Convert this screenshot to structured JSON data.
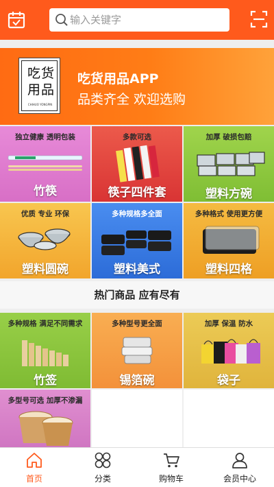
{
  "header": {
    "search_placeholder": "输入关键字",
    "left_icon": "calendar-icon",
    "right_icon": "scan-icon"
  },
  "banner": {
    "logo_text": "吃货用品",
    "logo_subtext": "CHIHUO YONGPIN",
    "title": "吃货用品APP",
    "subtitle": "品类齐全 欢迎选购"
  },
  "categories": [
    {
      "tag": "独立健康 透明包装",
      "name": "竹筷",
      "bg": "#e07fce"
    },
    {
      "tag": "多款可选",
      "name": "筷子四件套",
      "bg": "#e5453f"
    },
    {
      "tag": "加厚 破损包赔",
      "name": "塑料方碗",
      "bg": "#8ec93d"
    },
    {
      "tag": "优质 专业 环保",
      "name": "塑料圆碗",
      "bg": "#f6b93b"
    },
    {
      "tag": "多种规格多全面",
      "name": "塑料美式",
      "bg": "#3b7fe8"
    },
    {
      "tag": "多种格式 使用更方便",
      "name": "塑料四格",
      "bg": "#f2aa2f"
    }
  ],
  "section": {
    "title": "热门商品 应有尽有"
  },
  "hot_products": [
    {
      "tag": "多种规格 满足不同需求",
      "name": "竹签",
      "bg": "#8dc63f"
    },
    {
      "tag": "多种型号更全面",
      "name": "锡箔碗",
      "bg": "#f7a24a"
    },
    {
      "tag": "加厚 保温 防水",
      "name": "袋子",
      "bg": "#e6c24b"
    },
    {
      "tag": "多型号可选 加厚不渗漏",
      "name": "",
      "bg": "#d884c3"
    }
  ],
  "bottom_nav": [
    {
      "label": "首页",
      "icon": "home-icon",
      "active": true
    },
    {
      "label": "分类",
      "icon": "category-icon",
      "active": false
    },
    {
      "label": "购物车",
      "icon": "cart-icon",
      "active": false
    },
    {
      "label": "会员中心",
      "icon": "user-icon",
      "active": false
    }
  ],
  "colors": {
    "accent": "#ff5a1c",
    "banner": "#ff7d16"
  }
}
